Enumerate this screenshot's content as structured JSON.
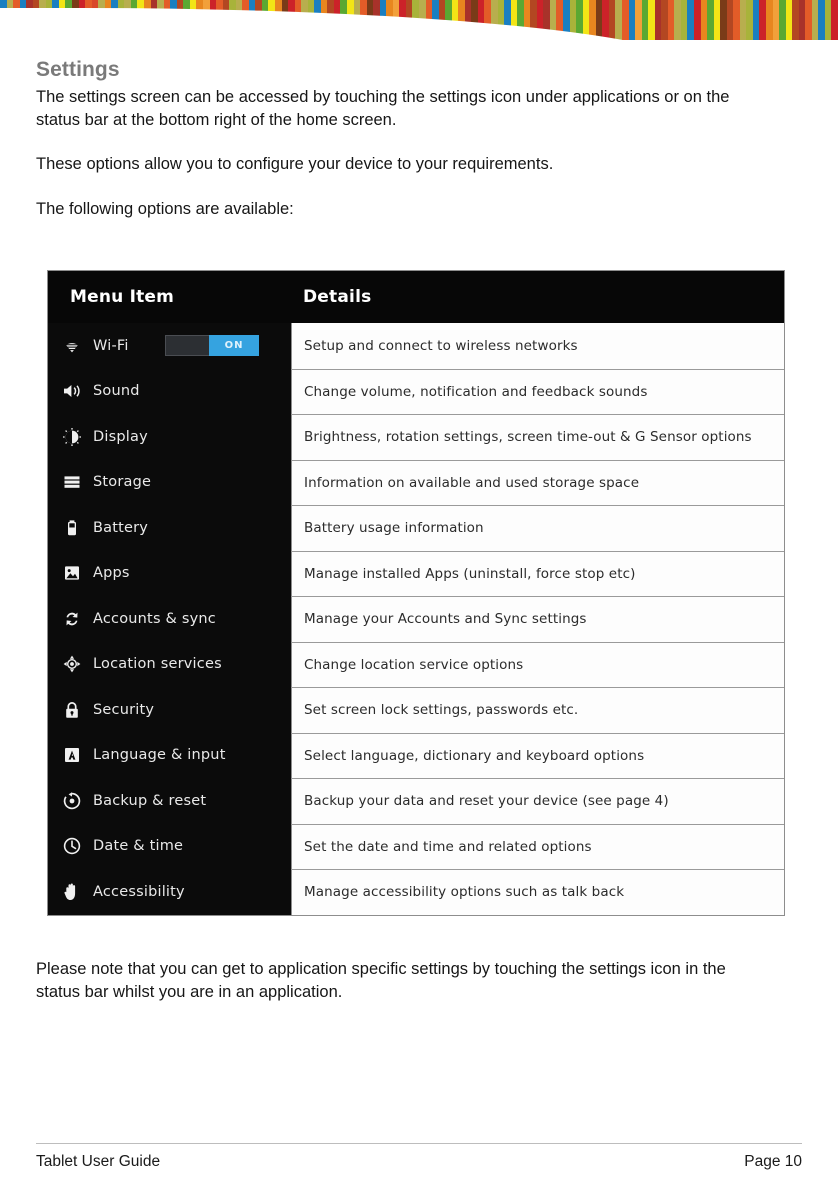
{
  "decoration": {
    "stripe_colors": [
      "#1a7fc1",
      "#b8ae4e",
      "#e35c28",
      "#1a7fc1",
      "#a8322a",
      "#b34722",
      "#b8ae4e",
      "#a8b33a",
      "#1a7fc1",
      "#f2e516",
      "#5aa832",
      "#7a3b18",
      "#cc2229",
      "#e35c28",
      "#d9482a",
      "#b8ae4e",
      "#e8861f",
      "#1a7fc1",
      "#a8b33a",
      "#b8ae4e",
      "#5aa832",
      "#f2e516",
      "#e8861f",
      "#a8322a",
      "#b8ae4e",
      "#e35c28",
      "#1a7fc1",
      "#b34722",
      "#5aa832",
      "#f2e516",
      "#e8861f",
      "#f2a03a",
      "#cc2229",
      "#e35c28",
      "#b34722",
      "#a8b33a",
      "#b8ae4e",
      "#e35c28",
      "#1a7fc1",
      "#b34722",
      "#5aa832",
      "#f2e516",
      "#e8861f",
      "#7a3b18",
      "#cc2229",
      "#e35c28",
      "#b8ae4e",
      "#a8b33a",
      "#1a7fc1",
      "#e8861f",
      "#b34722",
      "#cc2229",
      "#5aa832",
      "#f2e516",
      "#b8ae4e",
      "#e35c28",
      "#7a3b18",
      "#a8322a",
      "#1a7fc1",
      "#e8861f",
      "#f2a03a",
      "#cc2229",
      "#b34722",
      "#a8b33a",
      "#b8ae4e",
      "#e35c28",
      "#1a7fc1",
      "#b34722",
      "#5aa832",
      "#f2e516",
      "#e8861f",
      "#a8322a",
      "#7a3b18",
      "#cc2229",
      "#e35c28",
      "#b8ae4e",
      "#a8b33a",
      "#1a7fc1",
      "#f2e516",
      "#5aa832",
      "#e8861f",
      "#b34722",
      "#cc2229",
      "#a8322a",
      "#b8ae4e",
      "#e35c28",
      "#1a7fc1",
      "#a8b33a",
      "#5aa832",
      "#f2e516",
      "#e8861f",
      "#7a3b18",
      "#cc2229",
      "#b34722",
      "#b8ae4e",
      "#e35c28",
      "#1a7fc1",
      "#f2a03a",
      "#5aa832",
      "#f2e516",
      "#a8322a",
      "#b34722",
      "#e35c28",
      "#b8ae4e",
      "#a8b33a",
      "#1a7fc1",
      "#cc2229",
      "#e8861f",
      "#5aa832",
      "#f2e516",
      "#7a3b18",
      "#b34722",
      "#e35c28",
      "#b8ae4e",
      "#a8b33a",
      "#1a7fc1",
      "#cc2229",
      "#e8861f",
      "#f2a03a",
      "#5aa832",
      "#f2e516",
      "#b34722",
      "#a8322a",
      "#e35c28",
      "#b8ae4e",
      "#1a7fc1",
      "#a8b33a",
      "#cc2229"
    ]
  },
  "page": {
    "title": "Settings",
    "paragraph_1": "The settings screen can be accessed by touching the settings icon under applications or on the status bar at the bottom right of the home screen.",
    "paragraph_2": "These options allow you to configure your device to your requirements.",
    "paragraph_3": "The following options are available:",
    "paragraph_4": "Please note that you can get to application specific settings by touching the settings icon in the status bar whilst you are in an application."
  },
  "settings_table": {
    "headers": {
      "menu_item": "Menu Item",
      "details": "Details"
    },
    "toggle": {
      "on_label": "ON",
      "on_color": "#35a3e0"
    },
    "rows": [
      {
        "icon": "wifi-icon",
        "label": "Wi-Fi",
        "details": "Setup and connect to wireless networks",
        "has_toggle": true
      },
      {
        "icon": "sound-icon",
        "label": "Sound",
        "details": "Change volume, notification and feedback sounds",
        "has_toggle": false
      },
      {
        "icon": "display-icon",
        "label": "Display",
        "details": "Brightness, rotation settings, screen time-out & G Sensor options",
        "has_toggle": false
      },
      {
        "icon": "storage-icon",
        "label": "Storage",
        "details": "Information on available and used storage space",
        "has_toggle": false
      },
      {
        "icon": "battery-icon",
        "label": "Battery",
        "details": "Battery usage information",
        "has_toggle": false
      },
      {
        "icon": "apps-icon",
        "label": "Apps",
        "details": "Manage installed Apps (uninstall, force stop etc)",
        "has_toggle": false
      },
      {
        "icon": "sync-icon",
        "label": "Accounts & sync",
        "details": "Manage your Accounts and Sync settings",
        "has_toggle": false
      },
      {
        "icon": "location-icon",
        "label": "Location services",
        "details": "Change location service options",
        "has_toggle": false
      },
      {
        "icon": "lock-icon",
        "label": "Security",
        "details": "Set screen lock settings, passwords etc.",
        "has_toggle": false
      },
      {
        "icon": "language-icon",
        "label": "Language & input",
        "details": "Select language, dictionary and keyboard options",
        "has_toggle": false
      },
      {
        "icon": "backup-reset-icon",
        "label": "Backup & reset",
        "details": "Backup your data and reset your device (see page 4)",
        "has_toggle": false
      },
      {
        "icon": "clock-icon",
        "label": "Date & time",
        "details": "Set the date and time and related options",
        "has_toggle": false
      },
      {
        "icon": "accessibility-icon",
        "label": "Accessibility",
        "details": "Manage accessibility options such as talk back",
        "has_toggle": false
      }
    ]
  },
  "footer": {
    "left": "Tablet User Guide",
    "right": "Page 10"
  }
}
